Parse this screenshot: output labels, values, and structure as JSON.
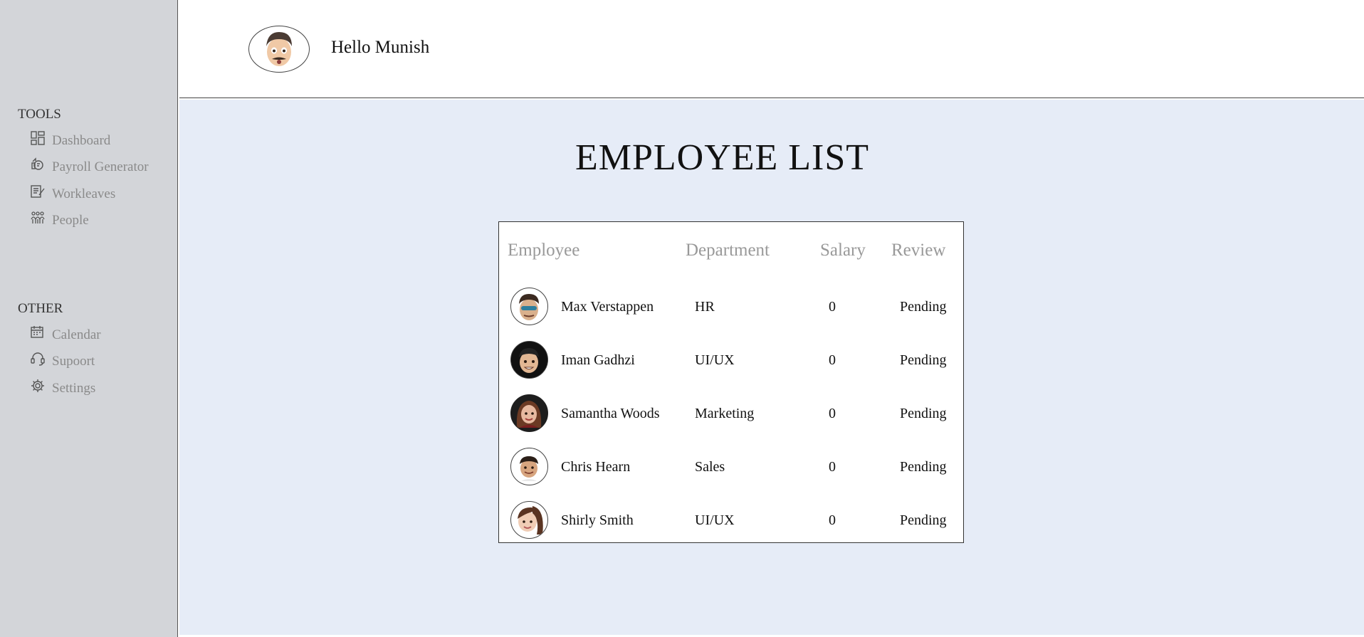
{
  "sidebar": {
    "sections": [
      {
        "title": "TOOLS",
        "items": [
          {
            "label": "Dashboard",
            "icon": "dashboard-icon"
          },
          {
            "label": "Payroll Generator",
            "icon": "payroll-icon"
          },
          {
            "label": "Workleaves",
            "icon": "workleaves-icon"
          },
          {
            "label": "People",
            "icon": "people-icon"
          }
        ]
      },
      {
        "title": "OTHER",
        "items": [
          {
            "label": "Calendar",
            "icon": "calendar-icon"
          },
          {
            "label": "Supoort",
            "icon": "headset-icon"
          },
          {
            "label": "Settings",
            "icon": "gear-icon"
          }
        ]
      }
    ]
  },
  "header": {
    "greeting": "Hello Munish",
    "avatar_icon": "user-avatar-icon"
  },
  "main": {
    "title": "EMPLOYEE LIST",
    "table": {
      "columns": [
        "Employee",
        "Department",
        "Salary",
        "Review"
      ],
      "rows": [
        {
          "name": "Max Verstappen",
          "department": "HR",
          "salary": "0",
          "review": "Pending",
          "avatar_color": "#d9b08c"
        },
        {
          "name": "Iman Gadhzi",
          "department": "UI/UX",
          "salary": "0",
          "review": "Pending",
          "avatar_color": "#e2b793"
        },
        {
          "name": "Samantha Woods",
          "department": "Marketing",
          "salary": "0",
          "review": "Pending",
          "avatar_color": "#e7b9a0"
        },
        {
          "name": "Chris Hearn",
          "department": "Sales",
          "salary": "0",
          "review": "Pending",
          "avatar_color": "#d7a57f"
        },
        {
          "name": "Shirly Smith",
          "department": "UI/UX",
          "salary": "0",
          "review": "Pending",
          "avatar_color": "#f0cdb5"
        }
      ]
    }
  }
}
